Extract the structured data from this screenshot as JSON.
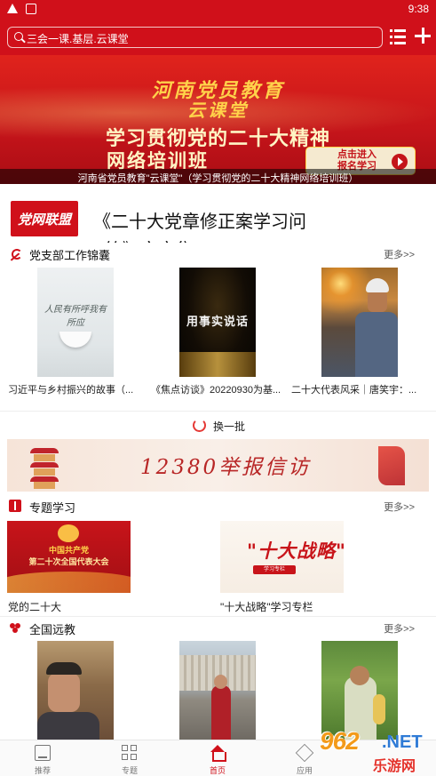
{
  "status_bar": {
    "time": "9:38"
  },
  "search": {
    "text": "三会一课.基层.云课堂"
  },
  "banner": {
    "line1": "河南党员教育",
    "line1b": "云课堂",
    "line2": "学习贯彻党的二十大精神",
    "line3": "网络培训班",
    "enter_button": "点击进入\n报名学习",
    "caption": "河南省党员教育\"云课堂\"（学习贯彻党的二十大精神网络培训班）"
  },
  "headline": {
    "logo": "党网联盟",
    "title": "《二十大党章修正案学习问",
    "title_cut": "答》文字集"
  },
  "sections": {
    "party_work": {
      "title": "党支部工作锦囊",
      "more": "更多>>",
      "items": [
        {
          "caption": "习近平与乡村振兴的故事（...",
          "art": "人民有所呼我有所应"
        },
        {
          "caption": "《焦点访谈》20220930为基...",
          "art": "用事实说话"
        },
        {
          "caption": "二十大代表风采｜唐笑宇：..."
        }
      ],
      "refresh": "换一批"
    },
    "report": {
      "text": "12380举报信访"
    },
    "topics": {
      "title": "专题学习",
      "more": "更多>>",
      "items": [
        {
          "caption": "党的二十大",
          "art_line1": "中国共产党",
          "art_line2": "第二十次全国代表大会"
        },
        {
          "caption": "\"十大战略\"学习专栏",
          "art": "\"十大战略\"",
          "art_tag": "学习专栏"
        }
      ]
    },
    "remote": {
      "title": "全国远教",
      "more": "更多>>"
    }
  },
  "bottom_nav": [
    {
      "label": "推荐",
      "icon": "document-icon",
      "active": false
    },
    {
      "label": "专题",
      "icon": "grid-icon",
      "active": false
    },
    {
      "label": "首页",
      "icon": "home-icon",
      "active": true
    },
    {
      "label": "应用",
      "icon": "cube-icon",
      "active": false
    }
  ],
  "watermark": {
    "number": "962",
    "net": ".NET",
    "site": "乐游网"
  },
  "colors": {
    "brand": "#d0101a",
    "accent_gold": "#ffd24a"
  }
}
